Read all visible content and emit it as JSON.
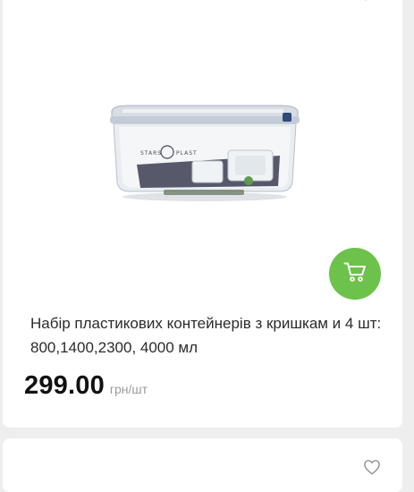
{
  "product": {
    "title": "Набір пластикових контейнерів з кришкам и 4 шт: 800,1400,2300, 4000 мл",
    "price": "299.00",
    "unit": "грн/шт",
    "image_brand": "STARS PLAST"
  },
  "icons": {
    "favorite": "heart-icon",
    "cart": "cart-icon"
  },
  "colors": {
    "accent": "#6cc24a",
    "card_background": "#ffffff",
    "page_background": "#eeeeee"
  }
}
